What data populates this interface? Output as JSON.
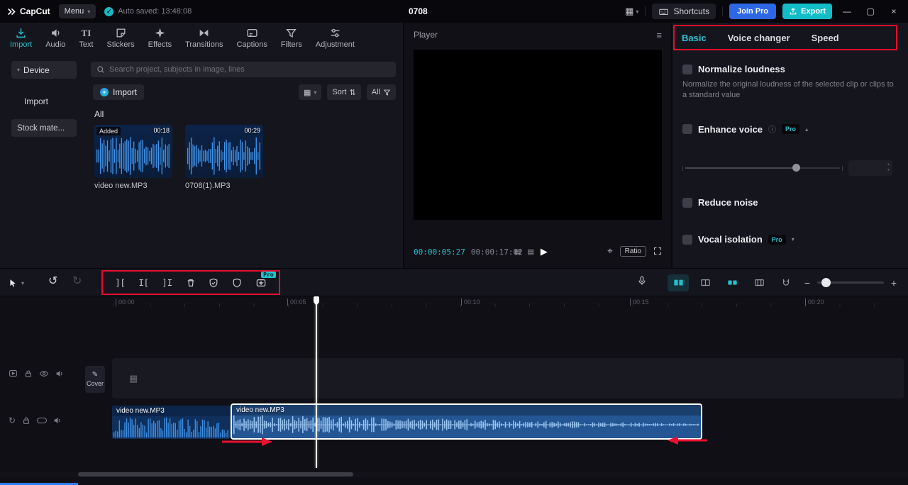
{
  "icons": {
    "chevron_down": "▾",
    "chevron_up": "▴",
    "check": "✓",
    "hamburger": "≡",
    "play": "▶",
    "grid": "▦",
    "sort_arrows": "⇅",
    "undo": "↺",
    "redo": "↻",
    "loop": "↻",
    "minimize": "—",
    "maximize": "▢",
    "close": "×",
    "minus": "−",
    "plus": "+",
    "pencil": "✎",
    "film": "▦",
    "frames": "▤",
    "focus": "⌖",
    "info": "ⓘ",
    "split": "][",
    "trim_left": "I[",
    "trim_right": "]I",
    "text_tab": "TI",
    "plus_small": "+"
  },
  "colors": {
    "accent_teal": "#27c0cd",
    "join_pro_blue": "#2d67e4",
    "export_teal": "#13bdc8",
    "annotation_red": "#e40e2d",
    "clip_selected_border": "#ffffff"
  },
  "titlebar": {
    "app_name": "CapCut",
    "menu": "Menu",
    "autosave": "Auto saved: 13:48:08",
    "project_title": "0708",
    "shortcuts": "Shortcuts",
    "join_pro": "Join Pro",
    "export": "Export"
  },
  "media_tabs": [
    {
      "label": "Import"
    },
    {
      "label": "Audio"
    },
    {
      "label": "Text"
    },
    {
      "label": "Stickers"
    },
    {
      "label": "Effects"
    },
    {
      "label": "Transitions"
    },
    {
      "label": "Captions"
    },
    {
      "label": "Filters"
    },
    {
      "label": "Adjustment"
    }
  ],
  "media_nav": {
    "device": "Device",
    "import": "Import",
    "stock": "Stock mate..."
  },
  "media": {
    "search_placeholder": "Search project, subjects in image, lines",
    "import_button": "Import",
    "sort": "Sort",
    "filter_all": "All",
    "section_title": "All",
    "items": [
      {
        "name": "video new.MP3",
        "duration": "00:18",
        "badge": "Added"
      },
      {
        "name": "0708(1).MP3",
        "duration": "00:29"
      }
    ]
  },
  "player": {
    "title": "Player",
    "current": "00:00:05:27",
    "total": "00:00:17:02",
    "ratio": "Ratio"
  },
  "properties": {
    "tabs": [
      {
        "label": "Basic"
      },
      {
        "label": "Voice changer"
      },
      {
        "label": "Speed"
      }
    ],
    "pro_label": "Pro",
    "normalize": {
      "label": "Normalize loudness",
      "desc": "Normalize the original loudness of the selected clip or clips to a standard value"
    },
    "enhance": {
      "label": "Enhance voice"
    },
    "reduce": {
      "label": "Reduce noise"
    },
    "vocal": {
      "label": "Vocal isolation"
    }
  },
  "toolbar": {
    "pro_label": "Pro"
  },
  "timeline": {
    "ruler": [
      {
        "t": "00:00"
      },
      {
        "t": "00:05"
      },
      {
        "t": "00:10"
      },
      {
        "t": "00:15"
      },
      {
        "t": "00:20"
      }
    ],
    "cover": "Cover",
    "clips": [
      {
        "name": "video new.MP3"
      },
      {
        "name": "video new.MP3"
      }
    ]
  },
  "waveforms": {
    "thumb1": {
      "bars": 42,
      "seed": 7,
      "min": 0.25,
      "max": 1.0,
      "decay": 0,
      "anchor": "center",
      "color": "#3f93ea"
    },
    "thumb2": {
      "bars": 42,
      "seed": 13,
      "min": 0.2,
      "max": 1.0,
      "decay": 0,
      "anchor": "center",
      "color": "#3f93ea"
    },
    "clip1": {
      "bars": 64,
      "seed": 5,
      "min": 0.2,
      "max": 0.95,
      "decay": 0,
      "anchor": "bottom",
      "color": "#3b8fe4"
    },
    "clip2": {
      "bars": 230,
      "seed": 9,
      "min": 0.06,
      "max": 0.95,
      "decay": 0.9,
      "anchor": "center",
      "color": "#9cc6f2",
      "baseline": true
    }
  }
}
